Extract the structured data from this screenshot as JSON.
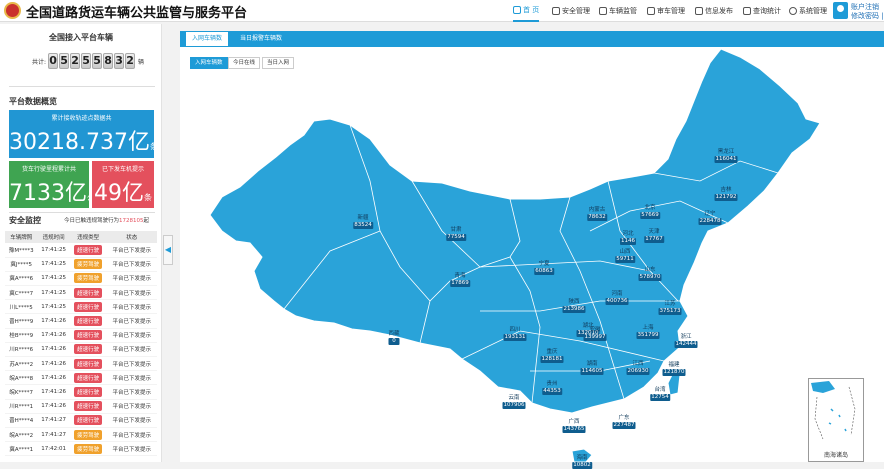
{
  "header": {
    "title": "全国道路货运车辆公共监管与服务平台",
    "nav": [
      {
        "label": "首 页",
        "icon": "home-icon",
        "active": true
      },
      {
        "label": "安全管理",
        "icon": "shield-icon"
      },
      {
        "label": "车辆监管",
        "icon": "truck-icon"
      },
      {
        "label": "审车管理",
        "icon": "search-car-icon"
      },
      {
        "label": "信息发布",
        "icon": "document-icon"
      },
      {
        "label": "查询统计",
        "icon": "bar-chart-icon"
      },
      {
        "label": "系统管理",
        "icon": "gear-icon"
      }
    ],
    "user": {
      "logout": "账户注销",
      "change_password": "修改密码 |"
    }
  },
  "left": {
    "vehicle_title": "全国接入平台车辆",
    "counter": {
      "prefix": "共计:",
      "digits": [
        "0",
        "5",
        "2",
        "5",
        "5",
        "8",
        "3",
        "2"
      ],
      "suffix": "辆"
    },
    "overview_title": "平台数据概览",
    "card_track": {
      "label": "累计接收轨迹点数据共",
      "value": "30218.737亿",
      "unit": "条"
    },
    "card_mileage": {
      "label": "货车行驶里程累计共",
      "value": "7133亿",
      "unit": "公里"
    },
    "card_prompt": {
      "label": "已下发车机提示",
      "value": "49亿",
      "unit": "条"
    },
    "security_title": "安全监控",
    "security_date_prefix": "今日已触违规驾驶行为",
    "security_date_num": "1728105",
    "security_date_suffix": "起",
    "table": {
      "headers": [
        "车辆牌照",
        "违规时间",
        "违规类型",
        "状态"
      ],
      "rows": [
        {
          "plate": "豫M****3",
          "time": "17:41:25",
          "type": "超速行驶",
          "tcolor": "#e4505d",
          "status": "平台已下发提示"
        },
        {
          "plate": "冀J****5",
          "time": "17:41:25",
          "type": "疲劳驾驶",
          "tcolor": "#f0a12c",
          "status": "平台已下发提示"
        },
        {
          "plate": "冀A****6",
          "time": "17:41:25",
          "type": "疲劳驾驶",
          "tcolor": "#f0a12c",
          "status": "平台已下发提示"
        },
        {
          "plate": "冀C****7",
          "time": "17:41:25",
          "type": "超速行驶",
          "tcolor": "#e4505d",
          "status": "平台已下发提示"
        },
        {
          "plate": "川L****5",
          "time": "17:41:25",
          "type": "超速行驶",
          "tcolor": "#e4505d",
          "status": "平台已下发提示"
        },
        {
          "plate": "晋H****9",
          "time": "17:41:26",
          "type": "超速行驶",
          "tcolor": "#e4505d",
          "status": "平台已下发提示"
        },
        {
          "plate": "桂B****9",
          "time": "17:41:26",
          "type": "超速行驶",
          "tcolor": "#e4505d",
          "status": "平台已下发提示"
        },
        {
          "plate": "川R****6",
          "time": "17:41:26",
          "type": "超速行驶",
          "tcolor": "#e4505d",
          "status": "平台已下发提示"
        },
        {
          "plate": "苏A****2",
          "time": "17:41:26",
          "type": "超速行驶",
          "tcolor": "#e4505d",
          "status": "平台已下发提示"
        },
        {
          "plate": "皖A****8",
          "time": "17:41:26",
          "type": "超速行驶",
          "tcolor": "#e4505d",
          "status": "平台已下发提示"
        },
        {
          "plate": "皖K****7",
          "time": "17:41:26",
          "type": "超速行驶",
          "tcolor": "#e4505d",
          "status": "平台已下发提示"
        },
        {
          "plate": "川R****1",
          "time": "17:41:26",
          "type": "超速行驶",
          "tcolor": "#e4505d",
          "status": "平台已下发提示"
        },
        {
          "plate": "晋H****4",
          "time": "17:41:27",
          "type": "超速行驶",
          "tcolor": "#e4505d",
          "status": "平台已下发提示"
        },
        {
          "plate": "皖A****2",
          "time": "17:41:27",
          "type": "疲劳驾驶",
          "tcolor": "#f0a12c",
          "status": "平台已下发提示"
        },
        {
          "plate": "冀A****1",
          "time": "17:42:01",
          "type": "疲劳驾驶",
          "tcolor": "#f0a12c",
          "status": "平台已下发提示"
        }
      ]
    }
  },
  "main": {
    "tabs": [
      "入网车辆数",
      "当日报警车辆数"
    ],
    "subtabs": [
      "入网车辆数",
      "今日在线",
      "当日入网"
    ],
    "inset_label": "南海诸岛",
    "map_color": "#2aa3d9",
    "provinces": [
      {
        "name": "黑龙江",
        "value": "116041"
      },
      {
        "name": "吉林",
        "value": "121792"
      },
      {
        "name": "辽宁",
        "value": "228478"
      },
      {
        "name": "内蒙古",
        "value": "78632"
      },
      {
        "name": "北京",
        "value": "57669"
      },
      {
        "name": "天津",
        "value": "17767"
      },
      {
        "name": "河北",
        "value": "1146"
      },
      {
        "name": "山西",
        "value": "59711"
      },
      {
        "name": "新疆",
        "value": "83524"
      },
      {
        "name": "甘肃",
        "value": "77594"
      },
      {
        "name": "宁夏",
        "value": "60863"
      },
      {
        "name": "青海",
        "value": "17869"
      },
      {
        "name": "陕西",
        "value": "213986"
      },
      {
        "name": "山东",
        "value": "578970"
      },
      {
        "name": "河南",
        "value": "400736"
      },
      {
        "name": "西藏",
        "value": "0"
      },
      {
        "name": "四川",
        "value": "193131"
      },
      {
        "name": "湖北",
        "value": "132010"
      },
      {
        "name": "江苏",
        "value": "375173"
      },
      {
        "name": "安徽",
        "value": "139997"
      },
      {
        "name": "上海",
        "value": "351799"
      },
      {
        "name": "浙江",
        "value": "142444"
      },
      {
        "name": "重庆",
        "value": "128181"
      },
      {
        "name": "湖南",
        "value": "114605"
      },
      {
        "name": "江西",
        "value": "206930"
      },
      {
        "name": "福建",
        "value": "121870"
      },
      {
        "name": "贵州",
        "value": "44353"
      },
      {
        "name": "云南",
        "value": "107906"
      },
      {
        "name": "广西",
        "value": "143765"
      },
      {
        "name": "广东",
        "value": "227487"
      },
      {
        "name": "台湾",
        "value": "12754"
      },
      {
        "name": "海南",
        "value": "10802"
      }
    ]
  }
}
